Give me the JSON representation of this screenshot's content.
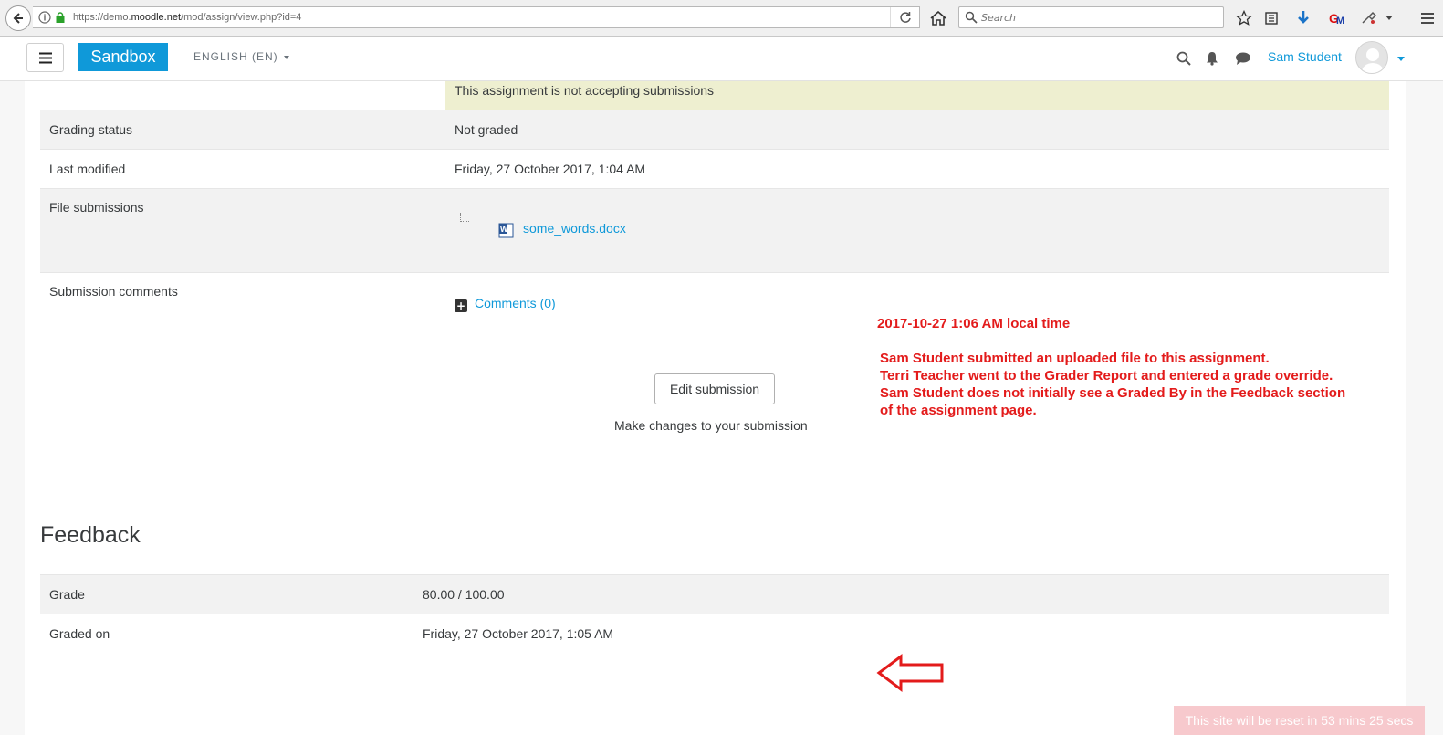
{
  "browser": {
    "url_prefix": "https://demo.",
    "url_domain": "moodle.net",
    "url_suffix": "/mod/assign/view.php?id=4",
    "search_placeholder": "Search"
  },
  "navbar": {
    "brand": "Sandbox",
    "language": "ENGLISH (EN)",
    "user_name": "Sam Student"
  },
  "submission": {
    "notice": "This assignment is not accepting submissions",
    "rows": [
      {
        "label": "Grading status",
        "value": "Not graded"
      },
      {
        "label": "Last modified",
        "value": "Friday, 27 October 2017, 1:04 AM"
      },
      {
        "label": "File submissions",
        "file": "some_words.docx"
      },
      {
        "label": "Submission comments",
        "comments_link": "Comments (0)"
      }
    ],
    "edit_button": "Edit submission",
    "edit_caption": "Make changes to your submission"
  },
  "annotation": {
    "timestamp": "2017-10-27 1:06 AM local time",
    "lines": [
      "Sam Student submitted an uploaded file to this assignment.",
      "Terri Teacher went to the Grader Report and entered a grade override.",
      "Sam Student does not initially see a Graded By in the Feedback section",
      "of the assignment page."
    ]
  },
  "feedback": {
    "heading": "Feedback",
    "rows": [
      {
        "label": "Grade",
        "value": "80.00 / 100.00"
      },
      {
        "label": "Graded on",
        "value": "Friday, 27 October 2017, 1:05 AM"
      }
    ]
  },
  "reset_banner": "This site will be reset in 53 mins 25 secs",
  "colors": {
    "brand": "#0f99d9",
    "link": "#0f99d9",
    "notice_bg": "#eeefd0",
    "annotation": "#e31b1b"
  }
}
